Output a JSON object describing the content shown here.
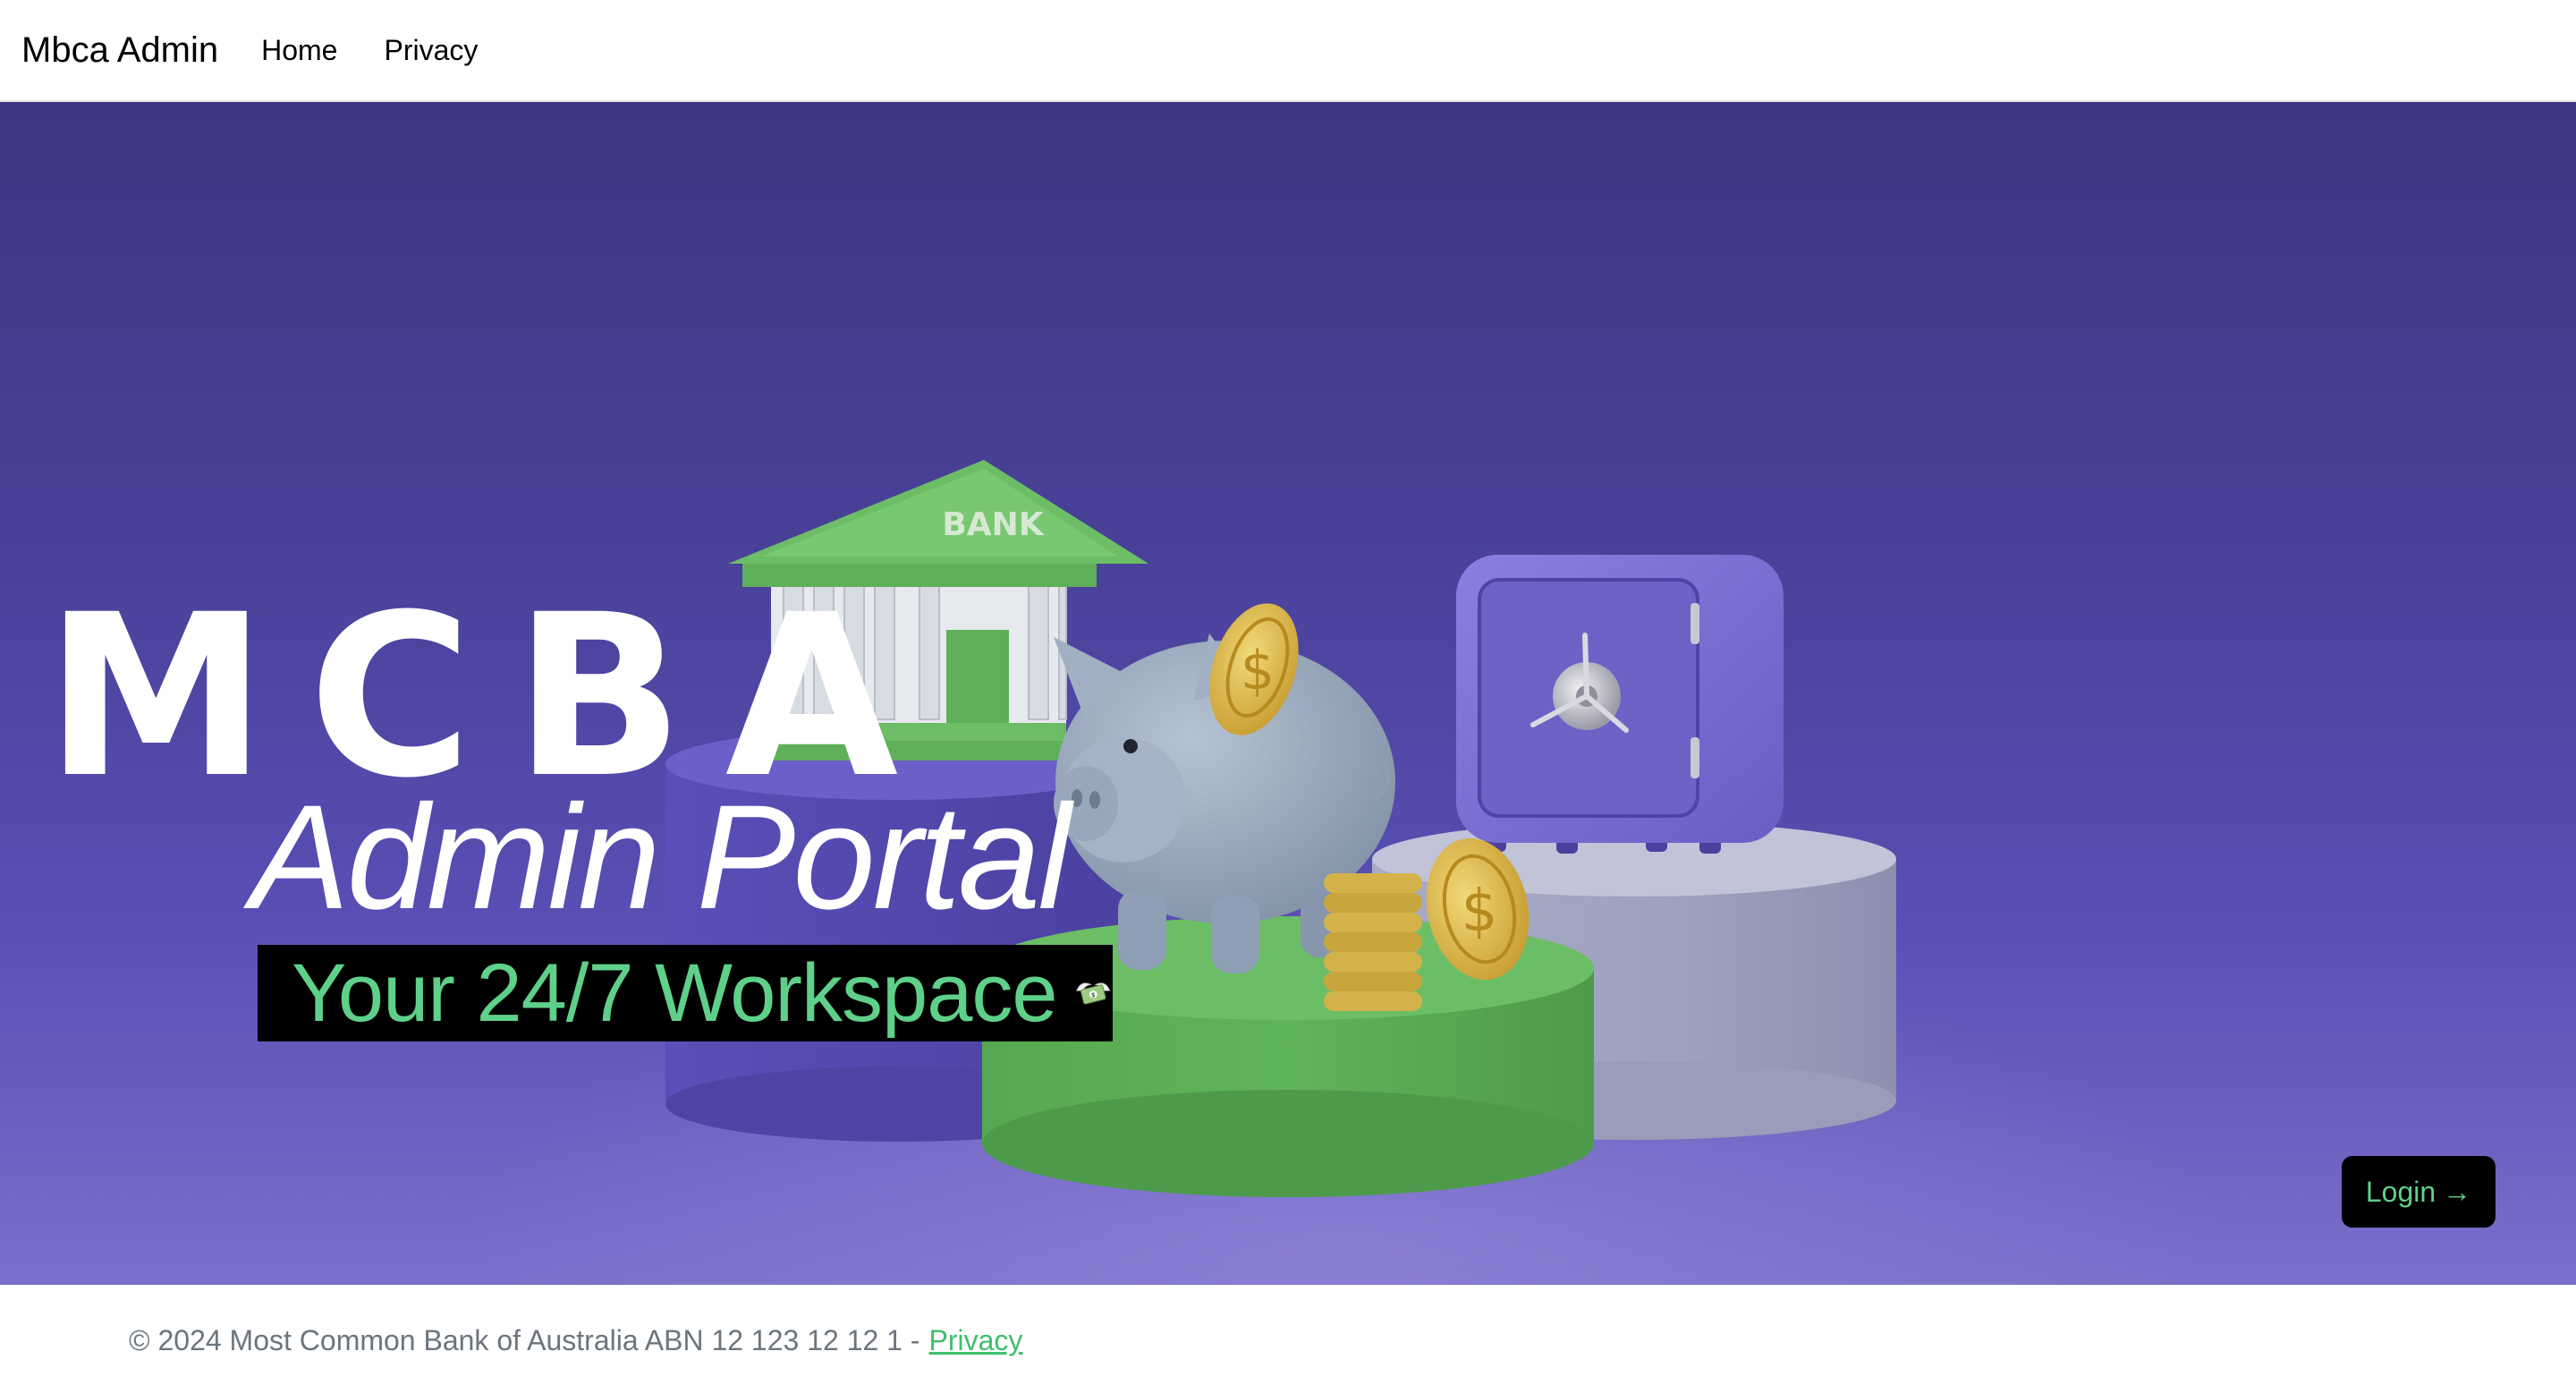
{
  "navbar": {
    "brand": "Mbca Admin",
    "links": [
      {
        "label": "Home"
      },
      {
        "label": "Privacy"
      }
    ]
  },
  "hero": {
    "logo_text": "MCBA",
    "title": "Admin Portal",
    "tagline": "Your 24/7 Workspace",
    "tagline_icon": "money-with-wings-icon",
    "bank_sign": "BANK",
    "login_label": "Login",
    "login_arrow": "→",
    "colors": {
      "background": "#4a429a",
      "accent_green": "#5fd08a",
      "bank_green": "#5fae5a",
      "safe_purple": "#7467cc",
      "pedestal_gray": "#a4a7c2"
    }
  },
  "footer": {
    "copyright": "© 2024 Most Common Bank of Australia ABN 12 123 12 12 1 -",
    "privacy_link": "Privacy"
  }
}
